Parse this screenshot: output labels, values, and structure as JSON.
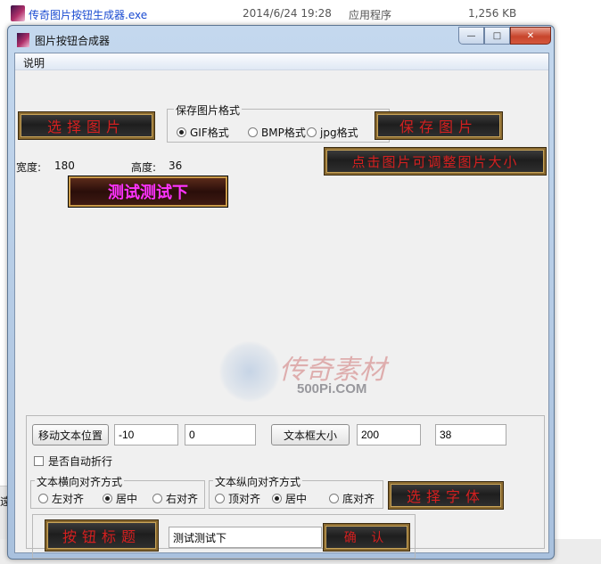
{
  "file_row": {
    "name": "传奇图片按钮生成器.exe",
    "date": "2014/6/24 19:28",
    "type": "应用程序",
    "size": "1,256 KB"
  },
  "background_fragment": "遠",
  "window": {
    "title": "图片按钮合成器",
    "menu": [
      "说明"
    ]
  },
  "buttons": {
    "select_image": "选择图片",
    "save_image": "保存图片",
    "resize_hint": "点击图片可调整图片大小",
    "select_font": "选择字体",
    "button_title": "按钮标题",
    "confirm": "确  认",
    "move_text": "移动文本位置",
    "textbox_size": "文本框大小"
  },
  "format_group": {
    "label": "保存图片格式",
    "options": [
      "GIF格式",
      "BMP格式",
      "jpg格式"
    ],
    "selected": 0
  },
  "dims": {
    "width_label": "宽度:",
    "width_value": "180",
    "height_label": "高度:",
    "height_value": "36"
  },
  "preview_text": "测试测试下",
  "watermark": {
    "text": "传奇素材",
    "sub": "500Pi.COM"
  },
  "inputs": {
    "offset_x": "-10",
    "offset_y": "0",
    "box_w": "200",
    "box_h": "38",
    "title_text": "测试测试下"
  },
  "auto_wrap_label": "是否自动折行",
  "auto_wrap_checked": false,
  "h_align": {
    "label": "文本横向对齐方式",
    "options": [
      "左对齐",
      "居中",
      "右对齐"
    ],
    "selected": 1
  },
  "v_align": {
    "label": "文本纵向对齐方式",
    "options": [
      "顶对齐",
      "居中",
      "底对齐"
    ],
    "selected": 1
  }
}
